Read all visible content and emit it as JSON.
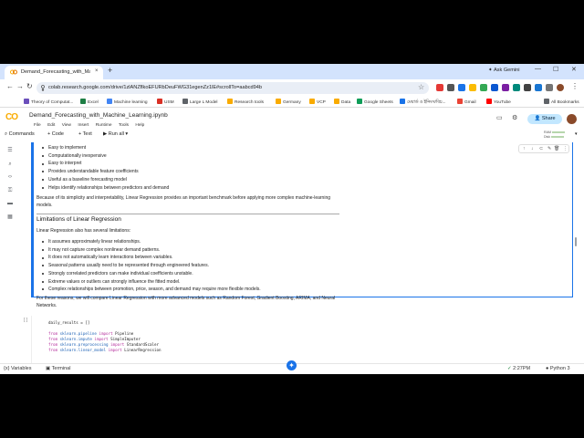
{
  "browser": {
    "tab_title": "Demand_Forecasting_with_Ma",
    "tab_close": "×",
    "new_tab": "+",
    "ask_gemini": "Ask Gemini",
    "url": "colab.research.google.com/drive/1zlANZflkoEFURbDeuFWG31egenZz1lE#scrollTo=aabcd94b",
    "bookmarks": [
      {
        "label": "Theory of Computat...",
        "color": "#6b4fbb"
      },
      {
        "label": "Excel",
        "color": "#1e7e45"
      },
      {
        "label": "Machine learning",
        "color": "#4285f4"
      },
      {
        "label": "USM",
        "color": "#d93025"
      },
      {
        "label": "Large L Model",
        "color": "#5f6368"
      },
      {
        "label": "Research tools",
        "color": "#f9ab00"
      },
      {
        "label": "Germany",
        "color": "#f9ab00"
      },
      {
        "label": "VCP",
        "color": "#f9ab00"
      },
      {
        "label": "Data",
        "color": "#f9ab00"
      },
      {
        "label": "Google Sheets",
        "color": "#0f9d58"
      },
      {
        "label": "মেয়ার্ড ও ইনিংস/বিচ...",
        "color": "#1a73e8"
      },
      {
        "label": "Gmail",
        "color": "#ea4335"
      },
      {
        "label": "YouTube",
        "color": "#ff0000"
      }
    ],
    "all_bookmarks": "All Bookmarks"
  },
  "colab": {
    "notebook_title": "Demand_Forecasting_with_Machine_Learning.ipynb",
    "menus": [
      "File",
      "Edit",
      "View",
      "Insert",
      "Runtime",
      "Tools",
      "Help"
    ],
    "share_label": "Share",
    "toolbar": {
      "commands": "Commands",
      "code": "+ Code",
      "text": "+ Text",
      "run_all": "Run all"
    },
    "ram_label": "RAM",
    "disk_label": "Disk"
  },
  "text_cell": {
    "advantages": [
      "Easy to implement",
      "Computationally inexpensive",
      "Easy to interpret",
      "Provides understandable feature coefficients",
      "Useful as a baseline forecasting model",
      "Helps identify relationships between predictors and demand"
    ],
    "summary_paragraph": "Because of its simplicity and interpretability, Linear Regression provides an important benchmark before applying more complex machine-learning models.",
    "limitations_heading": "Limitations of Linear Regression",
    "limitations_intro": "Linear Regression also has several limitations:",
    "limitations": [
      "It assumes approximately linear relationships.",
      "It may not capture complex nonlinear demand patterns.",
      "It does not automatically learn interactions between variables.",
      "Seasonal patterns usually need to be represented through engineered features.",
      "Strongly correlated predictors can make individual coefficients unstable.",
      "Extreme values or outliers can strongly influence the fitted model.",
      "Complex relationships between promotion, price, season, and demand may require more flexible models."
    ],
    "closing_paragraph": "For these reasons, we will compare Linear Regression with more advanced models such as Random Forest, Gradient Boosting, ARIMA, and Neural Networks."
  },
  "code_cell": {
    "lines": [
      {
        "kw": "",
        "rest": "daily_results = []"
      },
      {
        "kw": "",
        "rest": ""
      },
      {
        "kw": "from",
        "mod": " sklearn.pipeline ",
        "kw2": "import",
        "rest": " Pipeline"
      },
      {
        "kw": "from",
        "mod": " sklearn.impute ",
        "kw2": "import",
        "rest": " SimpleImputer"
      },
      {
        "kw": "from",
        "mod": " sklearn.preprocessing ",
        "kw2": "import",
        "rest": " StandardScaler"
      },
      {
        "kw": "from",
        "mod": " sklearn.linear_model ",
        "kw2": "import",
        "rest": " LinearRegression"
      }
    ]
  },
  "status_bar": {
    "variables": "Variables",
    "terminal": "Terminal",
    "time": "2:27PM",
    "runtime": "Python 3"
  }
}
